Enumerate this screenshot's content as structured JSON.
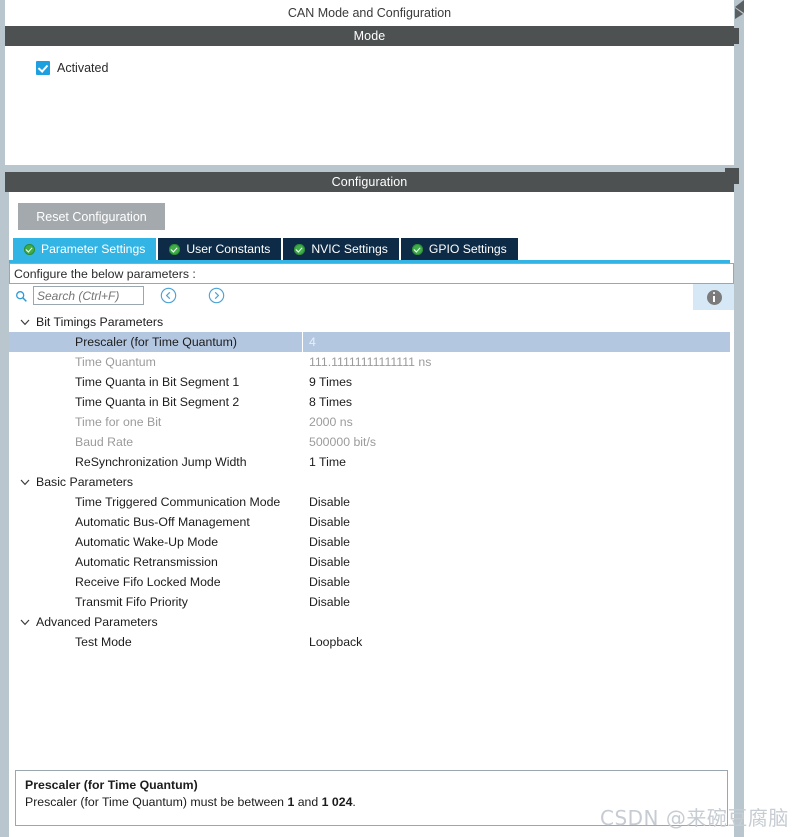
{
  "window": {
    "title": "CAN Mode and Configuration",
    "collapse_icon": "collapse-arrow-icon"
  },
  "mode": {
    "header": "Mode",
    "checkbox": {
      "label": "Activated",
      "checked": true
    }
  },
  "configuration": {
    "header": "Configuration",
    "reset_button": "Reset Configuration",
    "tabs": [
      {
        "label": "Parameter Settings",
        "active": true,
        "icon": "green-check-icon"
      },
      {
        "label": "User Constants",
        "active": false,
        "icon": "green-check-icon"
      },
      {
        "label": "NVIC Settings",
        "active": false,
        "icon": "green-check-icon"
      },
      {
        "label": "GPIO Settings",
        "active": false,
        "icon": "green-check-icon"
      }
    ],
    "instruction": "Configure the below parameters :",
    "search": {
      "placeholder": "Search (Ctrl+F)",
      "value": "",
      "icon": "search-icon",
      "prev_icon": "chevron-left-circle-icon",
      "next_icon": "chevron-right-circle-icon"
    },
    "info_button": {
      "icon": "info-icon"
    }
  },
  "parameters": {
    "groups": [
      {
        "name": "Bit Timings Parameters",
        "expanded": true,
        "rows": [
          {
            "name": "Prescaler (for Time Quantum)",
            "value": "4",
            "selected": true,
            "dimmed": false
          },
          {
            "name": "Time Quantum",
            "value": "111.11111111111111 ns",
            "selected": false,
            "dimmed": true
          },
          {
            "name": "Time Quanta in Bit Segment 1",
            "value": "9 Times",
            "selected": false,
            "dimmed": false
          },
          {
            "name": "Time Quanta in Bit Segment 2",
            "value": "8 Times",
            "selected": false,
            "dimmed": false
          },
          {
            "name": "Time for one Bit",
            "value": "2000 ns",
            "selected": false,
            "dimmed": true
          },
          {
            "name": "Baud Rate",
            "value": "500000 bit/s",
            "selected": false,
            "dimmed": true
          },
          {
            "name": "ReSynchronization Jump Width",
            "value": "1 Time",
            "selected": false,
            "dimmed": false
          }
        ]
      },
      {
        "name": "Basic Parameters",
        "expanded": true,
        "rows": [
          {
            "name": "Time Triggered Communication Mode",
            "value": "Disable",
            "selected": false,
            "dimmed": false
          },
          {
            "name": "Automatic Bus-Off Management",
            "value": "Disable",
            "selected": false,
            "dimmed": false
          },
          {
            "name": "Automatic Wake-Up Mode",
            "value": "Disable",
            "selected": false,
            "dimmed": false
          },
          {
            "name": "Automatic Retransmission",
            "value": "Disable",
            "selected": false,
            "dimmed": false
          },
          {
            "name": "Receive Fifo Locked Mode",
            "value": "Disable",
            "selected": false,
            "dimmed": false
          },
          {
            "name": "Transmit Fifo Priority",
            "value": "Disable",
            "selected": false,
            "dimmed": false
          }
        ]
      },
      {
        "name": "Advanced Parameters",
        "expanded": true,
        "rows": [
          {
            "name": "Test Mode",
            "value": "Loopback",
            "selected": false,
            "dimmed": false
          }
        ]
      }
    ]
  },
  "description": {
    "title": "Prescaler (for Time Quantum)",
    "text_prefix": "Prescaler (for Time Quantum) must be between ",
    "min": "1",
    "text_middle": " and ",
    "max": "1 024",
    "text_suffix": "."
  },
  "watermark": "CSDN @来碗豆腐脑",
  "colors": {
    "header_bar": "#4d5152",
    "active_tab": "#32b4e5",
    "inactive_tab": "#0d2b46",
    "selection": "#b3c7e0",
    "frame": "#b9c6ce",
    "tick_green": "#3fae49",
    "checkbox_blue": "#1e9fe0"
  }
}
